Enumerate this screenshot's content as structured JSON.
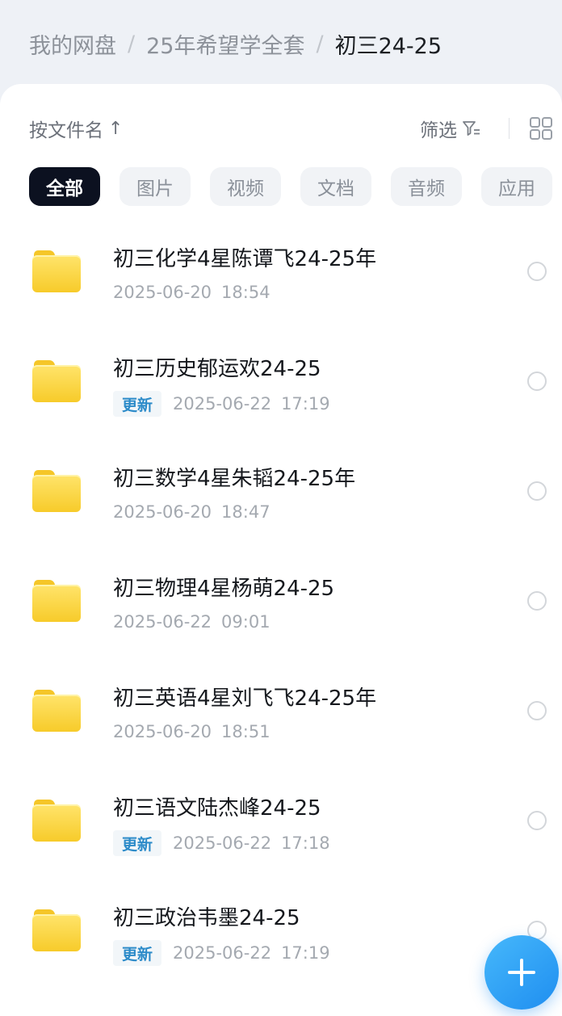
{
  "breadcrumb": {
    "items": [
      "我的网盘",
      "25年希望学全套",
      "初三24-25"
    ],
    "separator": "/"
  },
  "toolbar": {
    "sort_label": "按文件名",
    "sort_arrow": "↑",
    "filter_label": "筛选",
    "filter_icon": "filter-icon",
    "view_icon": "grid-view-icon"
  },
  "chips": [
    "全部",
    "图片",
    "视频",
    "文档",
    "音频",
    "应用"
  ],
  "active_chip": "全部",
  "files": [
    {
      "name": "初三化学4星陈谭飞24-25年",
      "badge": "",
      "date": "2025-06-20",
      "time": "18:54"
    },
    {
      "name": "初三历史郁运欢24-25",
      "badge": "更新",
      "date": "2025-06-22",
      "time": "17:19"
    },
    {
      "name": "初三数学4星朱韬24-25年",
      "badge": "",
      "date": "2025-06-20",
      "time": "18:47"
    },
    {
      "name": "初三物理4星杨萌24-25",
      "badge": "",
      "date": "2025-06-22",
      "time": "09:01"
    },
    {
      "name": "初三英语4星刘飞飞24-25年",
      "badge": "",
      "date": "2025-06-20",
      "time": "18:51"
    },
    {
      "name": "初三语文陆杰峰24-25",
      "badge": "更新",
      "date": "2025-06-22",
      "time": "17:18"
    },
    {
      "name": "初三政治韦墨24-25",
      "badge": "更新",
      "date": "2025-06-22",
      "time": "17:19"
    }
  ],
  "fab_icon": "plus-icon",
  "colors": {
    "accent": "#2c8bc9",
    "fab": "#2f9cf5",
    "folder": "#f7cb2a",
    "active_chip": "#0c1120"
  }
}
